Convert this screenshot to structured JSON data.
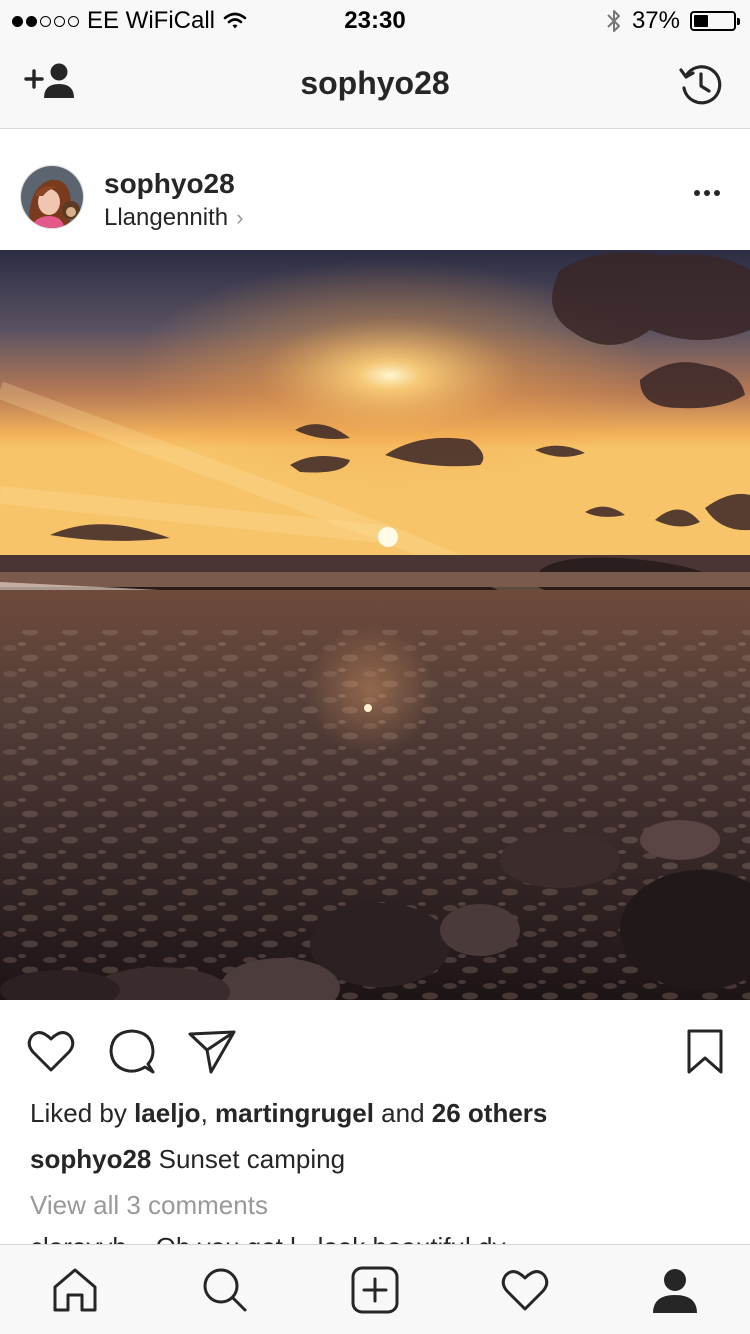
{
  "status_bar": {
    "carrier": "EE WiFiCall",
    "time": "23:30",
    "battery": "37%",
    "battery_level": 0.37
  },
  "header": {
    "title": "sophyo28",
    "left_icon": "add-user-icon",
    "right_icon": "history-icon"
  },
  "post": {
    "username": "sophyo28",
    "location": "Llangennith",
    "liked_prefix": "Liked by ",
    "liked_user1": "laeljo",
    "liked_sep": ", ",
    "liked_user2": "martingrugel",
    "liked_and": " and ",
    "liked_others": "26 others",
    "caption_user": "sophyo28",
    "caption_text": " Sunset camping",
    "view_comments": "View all 3 comments",
    "partial_comment": "claroyyb... Oh you get l.. look beautiful dy..."
  },
  "tabbar": {
    "items": [
      "home-icon",
      "search-icon",
      "new-post-icon",
      "activity-heart-icon",
      "profile-icon"
    ]
  },
  "colors": {
    "bar_bg": "#f8f8f8",
    "text": "#262626",
    "muted": "#999999"
  }
}
